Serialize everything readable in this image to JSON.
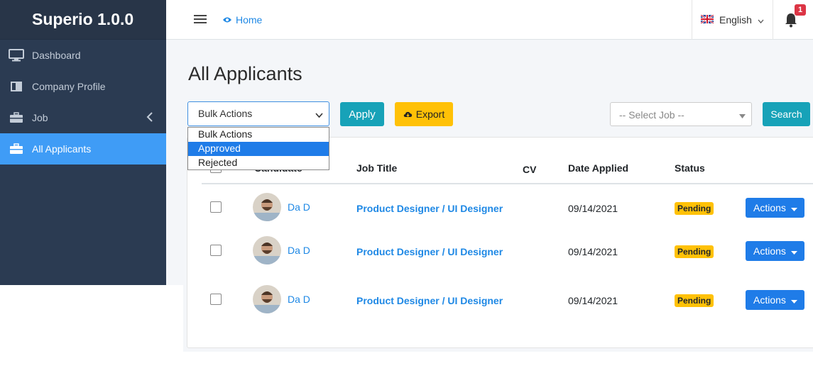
{
  "sidebar": {
    "brand": "Superio 1.0.0",
    "items": [
      {
        "label": "Dashboard",
        "icon": "monitor-icon"
      },
      {
        "label": "Company Profile",
        "icon": "book-icon"
      },
      {
        "label": "Job",
        "icon": "briefcase-icon"
      },
      {
        "label": "All Applicants",
        "icon": "briefcase-icon",
        "active": true
      }
    ]
  },
  "topbar": {
    "home_label": "Home",
    "language": "English",
    "notification_count": "1"
  },
  "page": {
    "title": "All Applicants",
    "bulk_select_value": "Bulk Actions",
    "bulk_options": [
      "Bulk Actions",
      "Approved",
      "Rejected"
    ],
    "bulk_selected_option": "Approved",
    "apply_label": "Apply",
    "export_label": "Export",
    "job_select_placeholder": "-- Select Job --",
    "search_label": "Search"
  },
  "table": {
    "columns": {
      "candidate": "Candidate",
      "job_title": "Job Title",
      "cv": "CV",
      "date_applied": "Date Applied",
      "status": "Status"
    },
    "rows": [
      {
        "name": "Da D",
        "job": "Product Designer / UI Designer",
        "date": "09/14/2021",
        "status": "Pending",
        "action": "Actions"
      },
      {
        "name": "Da D",
        "job": "Product Designer / UI Designer",
        "date": "09/14/2021",
        "status": "Pending",
        "action": "Actions"
      },
      {
        "name": "Da D",
        "job": "Product Designer / UI Designer",
        "date": "09/14/2021",
        "status": "Pending",
        "action": "Actions"
      }
    ]
  },
  "colors": {
    "sidebar_bg": "#2b3b52",
    "active_item": "#3f9cf6",
    "apply_btn": "#17a2b8",
    "export_btn": "#ffc107",
    "status_pending": "#ffc107",
    "actions_btn": "#1f7ce8"
  }
}
